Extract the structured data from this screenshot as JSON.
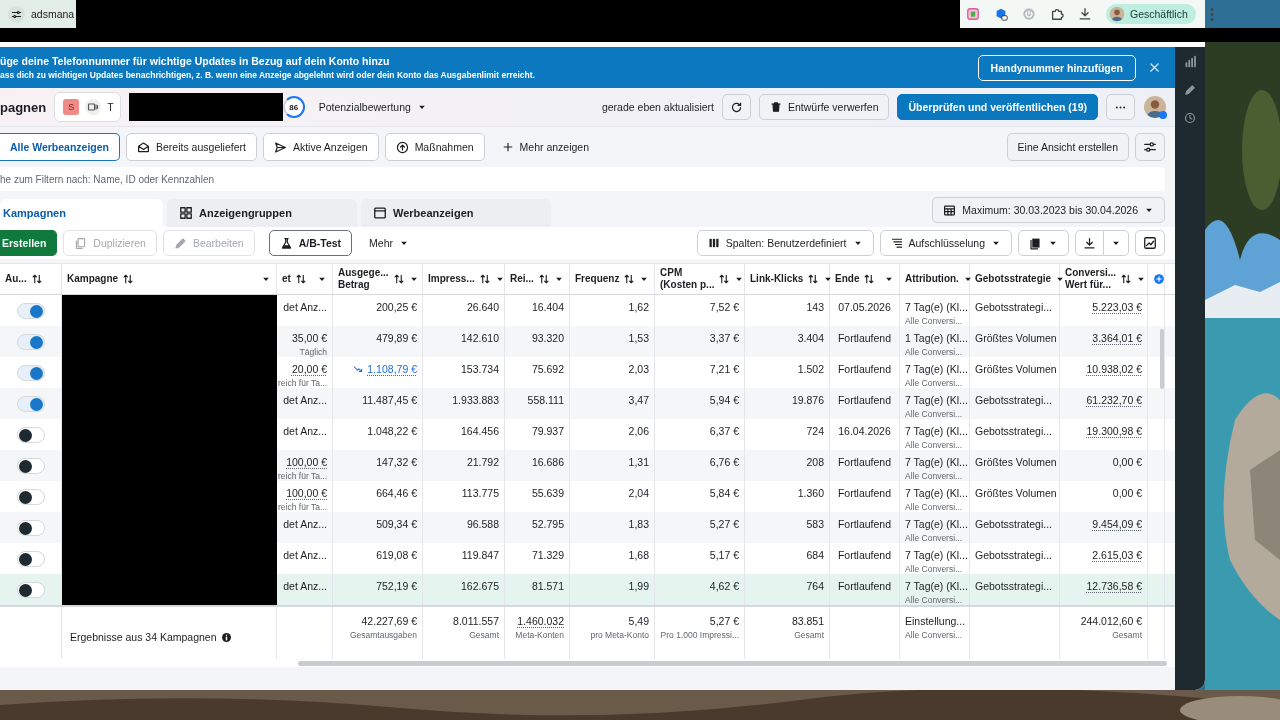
{
  "browser": {
    "tab_title": "adsmana",
    "profile": "Geschäftlich"
  },
  "banner": {
    "title": "üge deine Telefonnummer für wichtige Updates in Bezug auf dein Konto hinzu",
    "text": "ass dich zu wichtigen Updates benachrichtigen, z. B. wenn eine Anzeige abgelehnt wird oder dein Konto das Ausgabenlimit erreicht.",
    "button": "Handynummer hinzufügen"
  },
  "header": {
    "title": "pagnen",
    "account_initial": "S",
    "account_name": "T",
    "score": "86",
    "score_label": "Potenzialbewertung",
    "status": "gerade eben aktualisiert",
    "discard": "Entwürfe verwerfen",
    "publish": "Überprüfen und veröffentlichen (19)"
  },
  "filters": [
    {
      "label": "Alle Werbeanzeigen",
      "kind": "all",
      "selected": true
    },
    {
      "label": "Bereits ausgeliefert",
      "kind": "delivered",
      "selected": false
    },
    {
      "label": "Aktive Anzeigen",
      "kind": "active",
      "selected": false
    },
    {
      "label": "Maßnahmen",
      "kind": "actions",
      "selected": false
    }
  ],
  "more_filters": "Mehr anzeigen",
  "create_view": "Eine Ansicht erstellen",
  "search": {
    "placeholder": "he zum Filtern nach: Name, ID oder Kennzahlen"
  },
  "tabs": [
    {
      "label": "Kampagnen",
      "kind": "campaigns",
      "selected": true
    },
    {
      "label": "Anzeigengruppen",
      "kind": "adsets",
      "selected": false
    },
    {
      "label": "Werbeanzeigen",
      "kind": "ads",
      "selected": false
    }
  ],
  "date_range": "Maximum: 30.03.2023 bis 30.04.2026",
  "toolbar": [
    {
      "label": "Erstellen",
      "kind": "create",
      "disabled": false
    },
    {
      "label": "Duplizieren",
      "kind": "duplicate",
      "disabled": true
    },
    {
      "label": "Bearbeiten",
      "kind": "edit",
      "disabled": true
    },
    {
      "label": "A/B-Test",
      "kind": "abtest",
      "disabled": false
    },
    {
      "label": "Mehr",
      "kind": "more",
      "disabled": false
    }
  ],
  "columns_button": "Spalten: Benutzerdefiniert",
  "breakdown_button": "Aufschlüsselung",
  "table": {
    "columns": [
      {
        "label": "Au...",
        "sortable": true,
        "menu": false
      },
      {
        "label": "Kampagne",
        "sortable": true,
        "menu": true
      },
      {
        "label": "et",
        "sortable": true,
        "menu": true
      },
      {
        "label": "Ausgege...",
        "label2": "Betrag",
        "sortable": true,
        "menu": true
      },
      {
        "label": "Impress...",
        "sortable": true,
        "menu": true
      },
      {
        "label": "Rei...",
        "sortable": true,
        "menu": true
      },
      {
        "label": "Frequenz",
        "sortable": true,
        "menu": true
      },
      {
        "label": "CPM",
        "label2": "(Kosten p...",
        "sortable": true,
        "menu": true
      },
      {
        "label": "Link-Klicks",
        "sortable": true,
        "menu": true
      },
      {
        "label": "Ende",
        "sortable": true,
        "menu": true
      },
      {
        "label": "Attribution.",
        "sortable": false,
        "menu": true
      },
      {
        "label": "Gebotsstrategie",
        "sortable": false,
        "menu": true
      },
      {
        "label": "Conversi...",
        "label2": "Wert für...",
        "sortable": true,
        "menu": true
      }
    ],
    "rows": [
      {
        "hovered": false,
        "cells": [
          {
            "kind": "toggle",
            "on": true
          },
          "",
          {
            "text": "det Anz...",
            "kind": "plain"
          },
          {
            "text": "200,25 €",
            "kind": "plain"
          },
          {
            "text": "26.640",
            "kind": "plain"
          },
          {
            "text": "16.404",
            "kind": "plain"
          },
          {
            "text": "1,62",
            "kind": "plain"
          },
          {
            "text": "7,52 €",
            "kind": "plain"
          },
          {
            "text": "143",
            "kind": "plain"
          },
          {
            "text": "07.05.2026",
            "kind": "plain"
          },
          {
            "text": "7 Tag(e) (Kl...",
            "sub": "Alle Conversi...",
            "kind": "plain"
          },
          {
            "text": "Gebotsstrategi...",
            "kind": "plain"
          },
          {
            "text": "5.223,03 €",
            "kind": "dotted"
          }
        ]
      },
      {
        "hovered": false,
        "cells": [
          {
            "kind": "toggle",
            "on": true
          },
          "",
          {
            "text": "35,00 €",
            "sub": "Täglich",
            "kind": "plain"
          },
          {
            "text": "479,89 €",
            "kind": "plain"
          },
          {
            "text": "142.610",
            "kind": "plain"
          },
          {
            "text": "93.320",
            "kind": "plain"
          },
          {
            "text": "1,53",
            "kind": "plain"
          },
          {
            "text": "3,37 €",
            "kind": "plain"
          },
          {
            "text": "3.404",
            "kind": "plain"
          },
          {
            "text": "Fortlaufend",
            "kind": "plain"
          },
          {
            "text": "1 Tag(e) (Kl...",
            "sub": "Alle Conversi...",
            "kind": "plain"
          },
          {
            "text": "Größtes Volumen",
            "kind": "plain"
          },
          {
            "text": "3.364,01 €",
            "kind": "dotted"
          }
        ]
      },
      {
        "hovered": false,
        "cells": [
          {
            "kind": "toggle",
            "on": true
          },
          "",
          {
            "text": "20,00 €",
            "sub": "reich für Ta...",
            "kind": "dotted"
          },
          {
            "text": "1.108,79 €",
            "kind": "trend"
          },
          {
            "text": "153.734",
            "kind": "plain"
          },
          {
            "text": "75.692",
            "kind": "plain"
          },
          {
            "text": "2,03",
            "kind": "plain"
          },
          {
            "text": "7,21 €",
            "kind": "plain"
          },
          {
            "text": "1.502",
            "kind": "plain"
          },
          {
            "text": "Fortlaufend",
            "kind": "plain"
          },
          {
            "text": "7 Tag(e) (Kl...",
            "sub": "Alle Conversi...",
            "kind": "plain"
          },
          {
            "text": "Größtes Volumen",
            "kind": "plain"
          },
          {
            "text": "10.938,02 €",
            "kind": "dotted"
          }
        ]
      },
      {
        "hovered": false,
        "cells": [
          {
            "kind": "toggle",
            "on": true
          },
          "",
          {
            "text": "det Anz...",
            "kind": "plain"
          },
          {
            "text": "11.487,45 €",
            "kind": "plain"
          },
          {
            "text": "1.933.883",
            "kind": "plain"
          },
          {
            "text": "558.111",
            "kind": "plain"
          },
          {
            "text": "3,47",
            "kind": "plain"
          },
          {
            "text": "5,94 €",
            "kind": "plain"
          },
          {
            "text": "19.876",
            "kind": "plain"
          },
          {
            "text": "Fortlaufend",
            "kind": "plain"
          },
          {
            "text": "7 Tag(e) (Kl...",
            "sub": "Alle Conversi...",
            "kind": "plain"
          },
          {
            "text": "Gebotsstrategi...",
            "kind": "plain"
          },
          {
            "text": "61.232,70 €",
            "kind": "dotted"
          }
        ]
      },
      {
        "hovered": false,
        "cells": [
          {
            "kind": "toggle",
            "on": false
          },
          "",
          {
            "text": "det Anz...",
            "kind": "plain"
          },
          {
            "text": "1.048,22 €",
            "kind": "plain"
          },
          {
            "text": "164.456",
            "kind": "plain"
          },
          {
            "text": "79.937",
            "kind": "plain"
          },
          {
            "text": "2,06",
            "kind": "plain"
          },
          {
            "text": "6,37 €",
            "kind": "plain"
          },
          {
            "text": "724",
            "kind": "plain"
          },
          {
            "text": "16.04.2026",
            "kind": "plain"
          },
          {
            "text": "7 Tag(e) (Kl...",
            "sub": "Alle Conversi...",
            "kind": "plain"
          },
          {
            "text": "Gebotsstrategi...",
            "kind": "plain"
          },
          {
            "text": "19.300,98 €",
            "kind": "dotted"
          }
        ]
      },
      {
        "hovered": false,
        "cells": [
          {
            "kind": "toggle",
            "on": false
          },
          "",
          {
            "text": "100,00 €",
            "sub": "reich für Ta...",
            "kind": "dotted"
          },
          {
            "text": "147,32 €",
            "kind": "plain"
          },
          {
            "text": "21.792",
            "kind": "plain"
          },
          {
            "text": "16.686",
            "kind": "plain"
          },
          {
            "text": "1,31",
            "kind": "plain"
          },
          {
            "text": "6,76 €",
            "kind": "plain"
          },
          {
            "text": "208",
            "kind": "plain"
          },
          {
            "text": "Fortlaufend",
            "kind": "plain"
          },
          {
            "text": "7 Tag(e) (Kl...",
            "sub": "Alle Conversi...",
            "kind": "plain"
          },
          {
            "text": "Größtes Volumen",
            "kind": "plain"
          },
          {
            "text": "0,00 €",
            "kind": "plain"
          }
        ]
      },
      {
        "hovered": false,
        "cells": [
          {
            "kind": "toggle",
            "on": false
          },
          "",
          {
            "text": "100,00 €",
            "sub": "reich für Ta...",
            "kind": "dotted"
          },
          {
            "text": "664,46 €",
            "kind": "plain"
          },
          {
            "text": "113.775",
            "kind": "plain"
          },
          {
            "text": "55.639",
            "kind": "plain"
          },
          {
            "text": "2,04",
            "kind": "plain"
          },
          {
            "text": "5,84 €",
            "kind": "plain"
          },
          {
            "text": "1.360",
            "kind": "plain"
          },
          {
            "text": "Fortlaufend",
            "kind": "plain"
          },
          {
            "text": "7 Tag(e) (Kl...",
            "sub": "Alle Conversi...",
            "kind": "plain"
          },
          {
            "text": "Größtes Volumen",
            "kind": "plain"
          },
          {
            "text": "0,00 €",
            "kind": "plain"
          }
        ]
      },
      {
        "hovered": false,
        "cells": [
          {
            "kind": "toggle",
            "on": false
          },
          "",
          {
            "text": "det Anz...",
            "kind": "plain"
          },
          {
            "text": "509,34 €",
            "kind": "plain"
          },
          {
            "text": "96.588",
            "kind": "plain"
          },
          {
            "text": "52.795",
            "kind": "plain"
          },
          {
            "text": "1,83",
            "kind": "plain"
          },
          {
            "text": "5,27 €",
            "kind": "plain"
          },
          {
            "text": "583",
            "kind": "plain"
          },
          {
            "text": "Fortlaufend",
            "kind": "plain"
          },
          {
            "text": "7 Tag(e) (Kl...",
            "sub": "Alle Conversi...",
            "kind": "plain"
          },
          {
            "text": "Gebotsstrategi...",
            "kind": "plain"
          },
          {
            "text": "9.454,09 €",
            "kind": "dotted"
          }
        ]
      },
      {
        "hovered": false,
        "cells": [
          {
            "kind": "toggle",
            "on": false
          },
          "",
          {
            "text": "det Anz...",
            "kind": "plain"
          },
          {
            "text": "619,08 €",
            "kind": "plain"
          },
          {
            "text": "119.847",
            "kind": "plain"
          },
          {
            "text": "71.329",
            "kind": "plain"
          },
          {
            "text": "1,68",
            "kind": "plain"
          },
          {
            "text": "5,17 €",
            "kind": "plain"
          },
          {
            "text": "684",
            "kind": "plain"
          },
          {
            "text": "Fortlaufend",
            "kind": "plain"
          },
          {
            "text": "7 Tag(e) (Kl...",
            "sub": "Alle Conversi...",
            "kind": "plain"
          },
          {
            "text": "Gebotsstrategi...",
            "kind": "plain"
          },
          {
            "text": "2.615,03 €",
            "kind": "dotted"
          }
        ]
      },
      {
        "hovered": true,
        "cells": [
          {
            "kind": "toggle",
            "on": false
          },
          "",
          {
            "text": "det Anz...",
            "kind": "plain"
          },
          {
            "text": "752,19 €",
            "kind": "plain"
          },
          {
            "text": "162.675",
            "kind": "plain"
          },
          {
            "text": "81.571",
            "kind": "plain"
          },
          {
            "text": "1,99",
            "kind": "plain"
          },
          {
            "text": "4,62 €",
            "kind": "plain"
          },
          {
            "text": "764",
            "kind": "plain"
          },
          {
            "text": "Fortlaufend",
            "kind": "plain"
          },
          {
            "text": "7 Tag(e) (Kl...",
            "sub": "Alle Conversi...",
            "kind": "plain"
          },
          {
            "text": "Gebotsstrategi...",
            "kind": "plain"
          },
          {
            "text": "12.736,58 €",
            "kind": "dotted"
          }
        ]
      }
    ],
    "footer": {
      "cells": [
        "",
        {
          "text": "Ergebnisse aus 34 Kampagnen",
          "kind": "summary"
        },
        "",
        {
          "text": "42.227,69 €",
          "sub": "Gesamtausgaben",
          "kind": "plain"
        },
        {
          "text": "8.011.557",
          "sub": "Gesamt",
          "kind": "plain"
        },
        {
          "text": "1.460.032",
          "sub": "Meta-Konten",
          "kind": "dotted"
        },
        {
          "text": "5,49",
          "sub": "pro Meta-Konto",
          "kind": "plain"
        },
        {
          "text": "5,27 €",
          "sub": "Pro 1.000 Impressi...",
          "kind": "plain"
        },
        {
          "text": "83.851",
          "sub": "Gesamt",
          "kind": "plain"
        },
        "",
        {
          "text": "Einstellung...",
          "sub": "Alle Conversi...",
          "kind": "plain"
        },
        "",
        {
          "text": "244.012,60 €",
          "sub": "Gesamt",
          "kind": "plain"
        }
      ]
    }
  }
}
